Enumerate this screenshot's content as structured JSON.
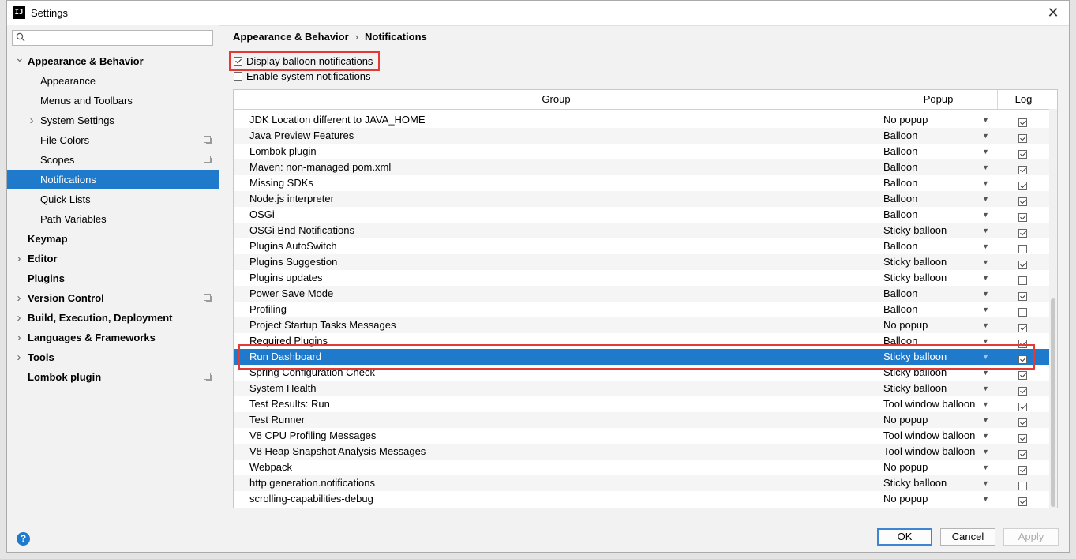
{
  "window": {
    "title": "Settings",
    "app_icon": "IJ",
    "close_glyph": "✕"
  },
  "search": {
    "placeholder": "",
    "icon": "search-icon"
  },
  "sidebar": {
    "items": [
      {
        "label": "Appearance & Behavior",
        "level": 0,
        "bold": true,
        "arrow": "expanded"
      },
      {
        "label": "Appearance",
        "level": 1,
        "bold": false,
        "arrow": "none"
      },
      {
        "label": "Menus and Toolbars",
        "level": 1,
        "bold": false,
        "arrow": "none"
      },
      {
        "label": "System Settings",
        "level": 1,
        "bold": false,
        "arrow": "collapsed"
      },
      {
        "label": "File Colors",
        "level": 1,
        "bold": false,
        "arrow": "none",
        "project_icon": true
      },
      {
        "label": "Scopes",
        "level": 1,
        "bold": false,
        "arrow": "none",
        "project_icon": true
      },
      {
        "label": "Notifications",
        "level": 1,
        "bold": false,
        "arrow": "none",
        "selected": true
      },
      {
        "label": "Quick Lists",
        "level": 1,
        "bold": false,
        "arrow": "none"
      },
      {
        "label": "Path Variables",
        "level": 1,
        "bold": false,
        "arrow": "none"
      },
      {
        "label": "Keymap",
        "level": 0,
        "bold": true,
        "arrow": "none"
      },
      {
        "label": "Editor",
        "level": 0,
        "bold": true,
        "arrow": "collapsed"
      },
      {
        "label": "Plugins",
        "level": 0,
        "bold": true,
        "arrow": "none"
      },
      {
        "label": "Version Control",
        "level": 0,
        "bold": true,
        "arrow": "collapsed",
        "project_icon": true
      },
      {
        "label": "Build, Execution, Deployment",
        "level": 0,
        "bold": true,
        "arrow": "collapsed"
      },
      {
        "label": "Languages & Frameworks",
        "level": 0,
        "bold": true,
        "arrow": "collapsed"
      },
      {
        "label": "Tools",
        "level": 0,
        "bold": true,
        "arrow": "collapsed"
      },
      {
        "label": "Lombok plugin",
        "level": 0,
        "bold": true,
        "arrow": "none",
        "project_icon": true
      }
    ]
  },
  "breadcrumb": {
    "parent": "Appearance & Behavior",
    "separator": "›",
    "current": "Notifications"
  },
  "options": {
    "display_balloon": {
      "label": "Display balloon notifications",
      "checked": true
    },
    "enable_system": {
      "label": "Enable system notifications",
      "checked": false
    }
  },
  "table": {
    "headers": {
      "group": "Group",
      "popup": "Popup",
      "log": "Log"
    },
    "rows": [
      {
        "group": "JDK Location different to JAVA_HOME",
        "popup": "No popup",
        "log": true
      },
      {
        "group": "Java Preview Features",
        "popup": "Balloon",
        "log": true
      },
      {
        "group": "Lombok plugin",
        "popup": "Balloon",
        "log": true
      },
      {
        "group": "Maven: non-managed pom.xml",
        "popup": "Balloon",
        "log": true
      },
      {
        "group": "Missing SDKs",
        "popup": "Balloon",
        "log": true
      },
      {
        "group": "Node.js interpreter",
        "popup": "Balloon",
        "log": true
      },
      {
        "group": "OSGi",
        "popup": "Balloon",
        "log": true
      },
      {
        "group": "OSGi Bnd Notifications",
        "popup": "Sticky balloon",
        "log": true
      },
      {
        "group": "Plugins AutoSwitch",
        "popup": "Balloon",
        "log": false
      },
      {
        "group": "Plugins Suggestion",
        "popup": "Sticky balloon",
        "log": true
      },
      {
        "group": "Plugins updates",
        "popup": "Sticky balloon",
        "log": false
      },
      {
        "group": "Power Save Mode",
        "popup": "Balloon",
        "log": true
      },
      {
        "group": "Profiling",
        "popup": "Balloon",
        "log": false
      },
      {
        "group": "Project Startup Tasks Messages",
        "popup": "No popup",
        "log": true
      },
      {
        "group": "Required Plugins",
        "popup": "Balloon",
        "log": true
      },
      {
        "group": "Run Dashboard",
        "popup": "Sticky balloon",
        "log": true,
        "selected": true
      },
      {
        "group": "Spring Configuration Check",
        "popup": "Sticky balloon",
        "log": true
      },
      {
        "group": "System Health",
        "popup": "Sticky balloon",
        "log": true
      },
      {
        "group": "Test Results: Run",
        "popup": "Tool window balloon",
        "log": true
      },
      {
        "group": "Test Runner",
        "popup": "No popup",
        "log": true
      },
      {
        "group": "V8 CPU Profiling Messages",
        "popup": "Tool window balloon",
        "log": true
      },
      {
        "group": "V8 Heap Snapshot Analysis Messages",
        "popup": "Tool window balloon",
        "log": true
      },
      {
        "group": "Webpack",
        "popup": "No popup",
        "log": true
      },
      {
        "group": "http.generation.notifications",
        "popup": "Sticky balloon",
        "log": false
      },
      {
        "group": "scrolling-capabilities-debug",
        "popup": "No popup",
        "log": true
      }
    ]
  },
  "footer": {
    "help": "?",
    "ok": "OK",
    "cancel": "Cancel",
    "apply": "Apply"
  },
  "colors": {
    "selection": "#1f7acb",
    "highlight_box": "#e53935",
    "ok_border": "#3c86d6"
  }
}
